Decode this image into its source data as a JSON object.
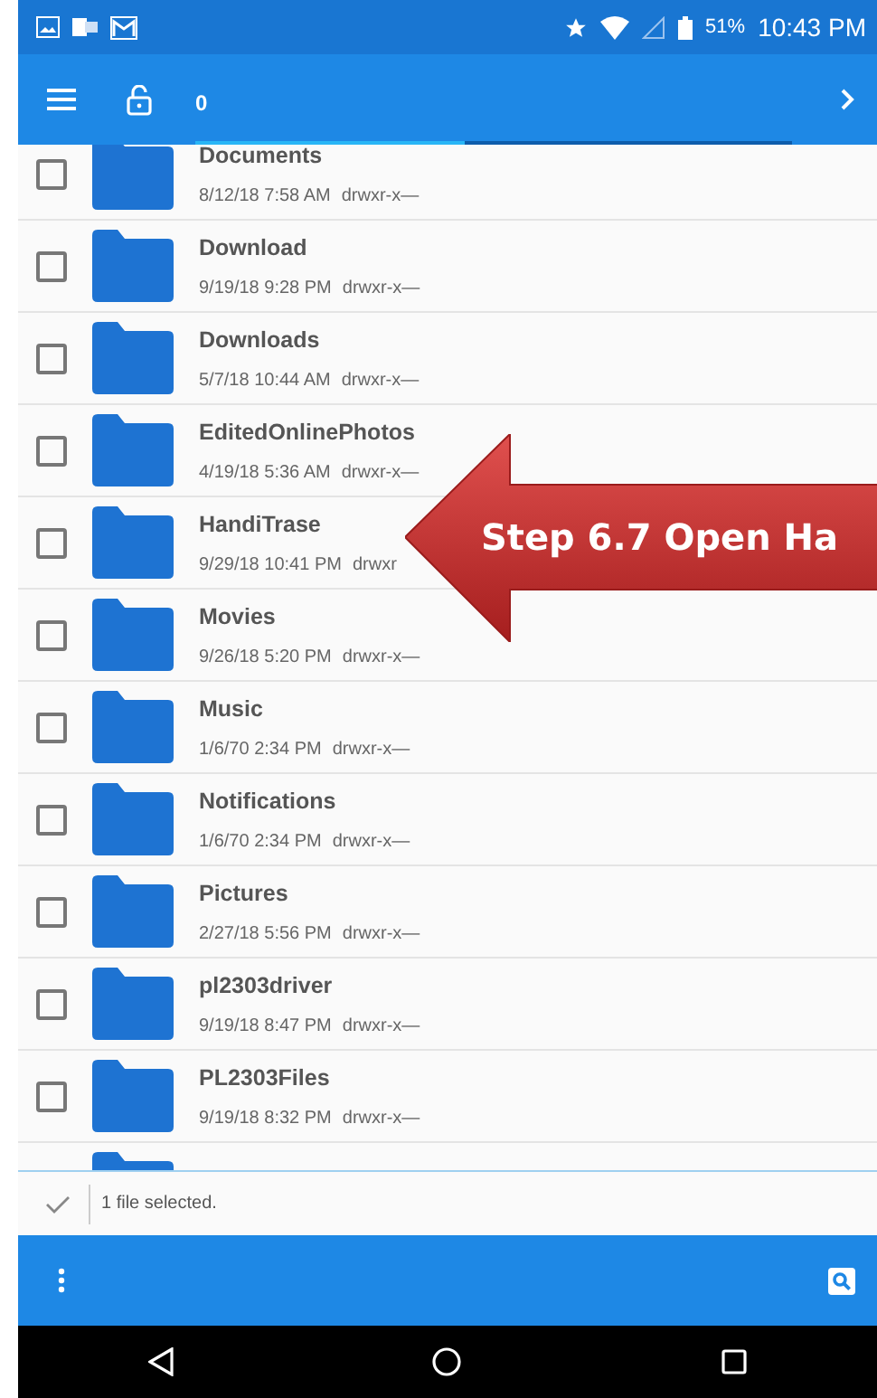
{
  "status_bar": {
    "battery": "51%",
    "time": "10:43 PM"
  },
  "toolbar": {
    "path_count": "0",
    "progress": {
      "level": 0.45
    }
  },
  "files": [
    {
      "name": "Documents",
      "date": "8/12/18 7:58 AM",
      "permissions": "drwxr-x—",
      "checked": false
    },
    {
      "name": "Download",
      "date": "9/19/18 9:28 PM",
      "permissions": "drwxr-x—",
      "checked": false
    },
    {
      "name": "Downloads",
      "date": "5/7/18 10:44 AM",
      "permissions": "drwxr-x—",
      "checked": false
    },
    {
      "name": "EditedOnlinePhotos",
      "date": "4/19/18 5:36 AM",
      "permissions": "drwxr-x—",
      "checked": false
    },
    {
      "name": "HandiTrase",
      "date": "9/29/18 10:41 PM",
      "permissions": "drwxr",
      "checked": false
    },
    {
      "name": "Movies",
      "date": "9/26/18 5:20 PM",
      "permissions": "drwxr-x—",
      "checked": false
    },
    {
      "name": "Music",
      "date": "1/6/70 2:34 PM",
      "permissions": "drwxr-x—",
      "checked": false
    },
    {
      "name": "Notifications",
      "date": "1/6/70 2:34 PM",
      "permissions": "drwxr-x—",
      "checked": false
    },
    {
      "name": "Pictures",
      "date": "2/27/18 5:56 PM",
      "permissions": "drwxr-x—",
      "checked": false
    },
    {
      "name": "pl2303driver",
      "date": "9/19/18 8:47 PM",
      "permissions": "drwxr-x—",
      "checked": false
    },
    {
      "name": "PL2303Files",
      "date": "9/19/18 8:32 PM",
      "permissions": "drwxr-x—",
      "checked": false
    }
  ],
  "selection_bar": {
    "text": "1 file selected."
  },
  "callout": {
    "text": "Step 6.7 Open Ha"
  }
}
